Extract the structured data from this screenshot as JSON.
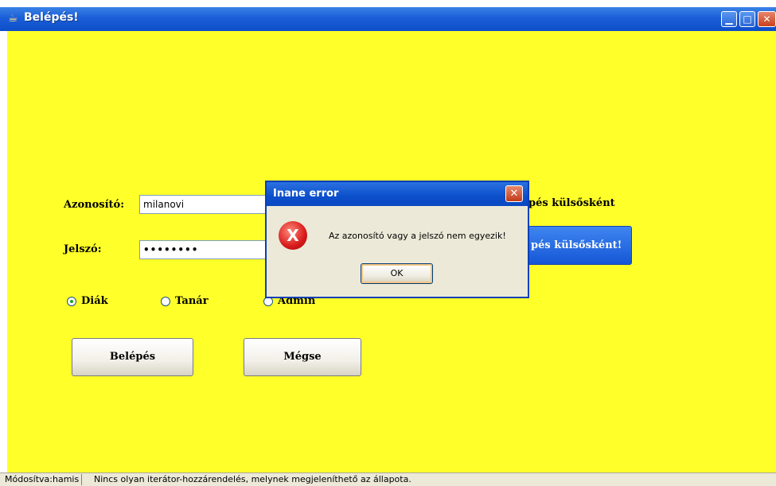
{
  "window": {
    "title": "Belépés!",
    "minimize_glyph": "▁",
    "maximize_glyph": "□",
    "close_glyph": "✕"
  },
  "form": {
    "username_label": "Azonosító:",
    "username_value": "milanovi",
    "password_label": "Jelszó:",
    "password_value": "••••••••",
    "external_login_label": "pés külsősként",
    "external_login_button": "pés külsősként!",
    "radio": [
      {
        "label": "Diák",
        "selected": true
      },
      {
        "label": "Tanár",
        "selected": false
      },
      {
        "label": "Admin",
        "selected": false
      }
    ],
    "login_button": "Belépés",
    "cancel_button": "Mégse"
  },
  "dialog": {
    "title": "Inane error",
    "message": "Az azonosító vagy a jelszó nem egyezik!",
    "ok_button": "OK",
    "error_glyph": "X",
    "close_glyph": "✕"
  },
  "status": {
    "modified": "Módosítva:hamis",
    "message": "Nincs olyan iterátor-hozzárendelés, melynek megjeleníthető az állapota."
  },
  "colors": {
    "client_background": "#ffff2a",
    "titlebar": "#1a5ed8"
  }
}
